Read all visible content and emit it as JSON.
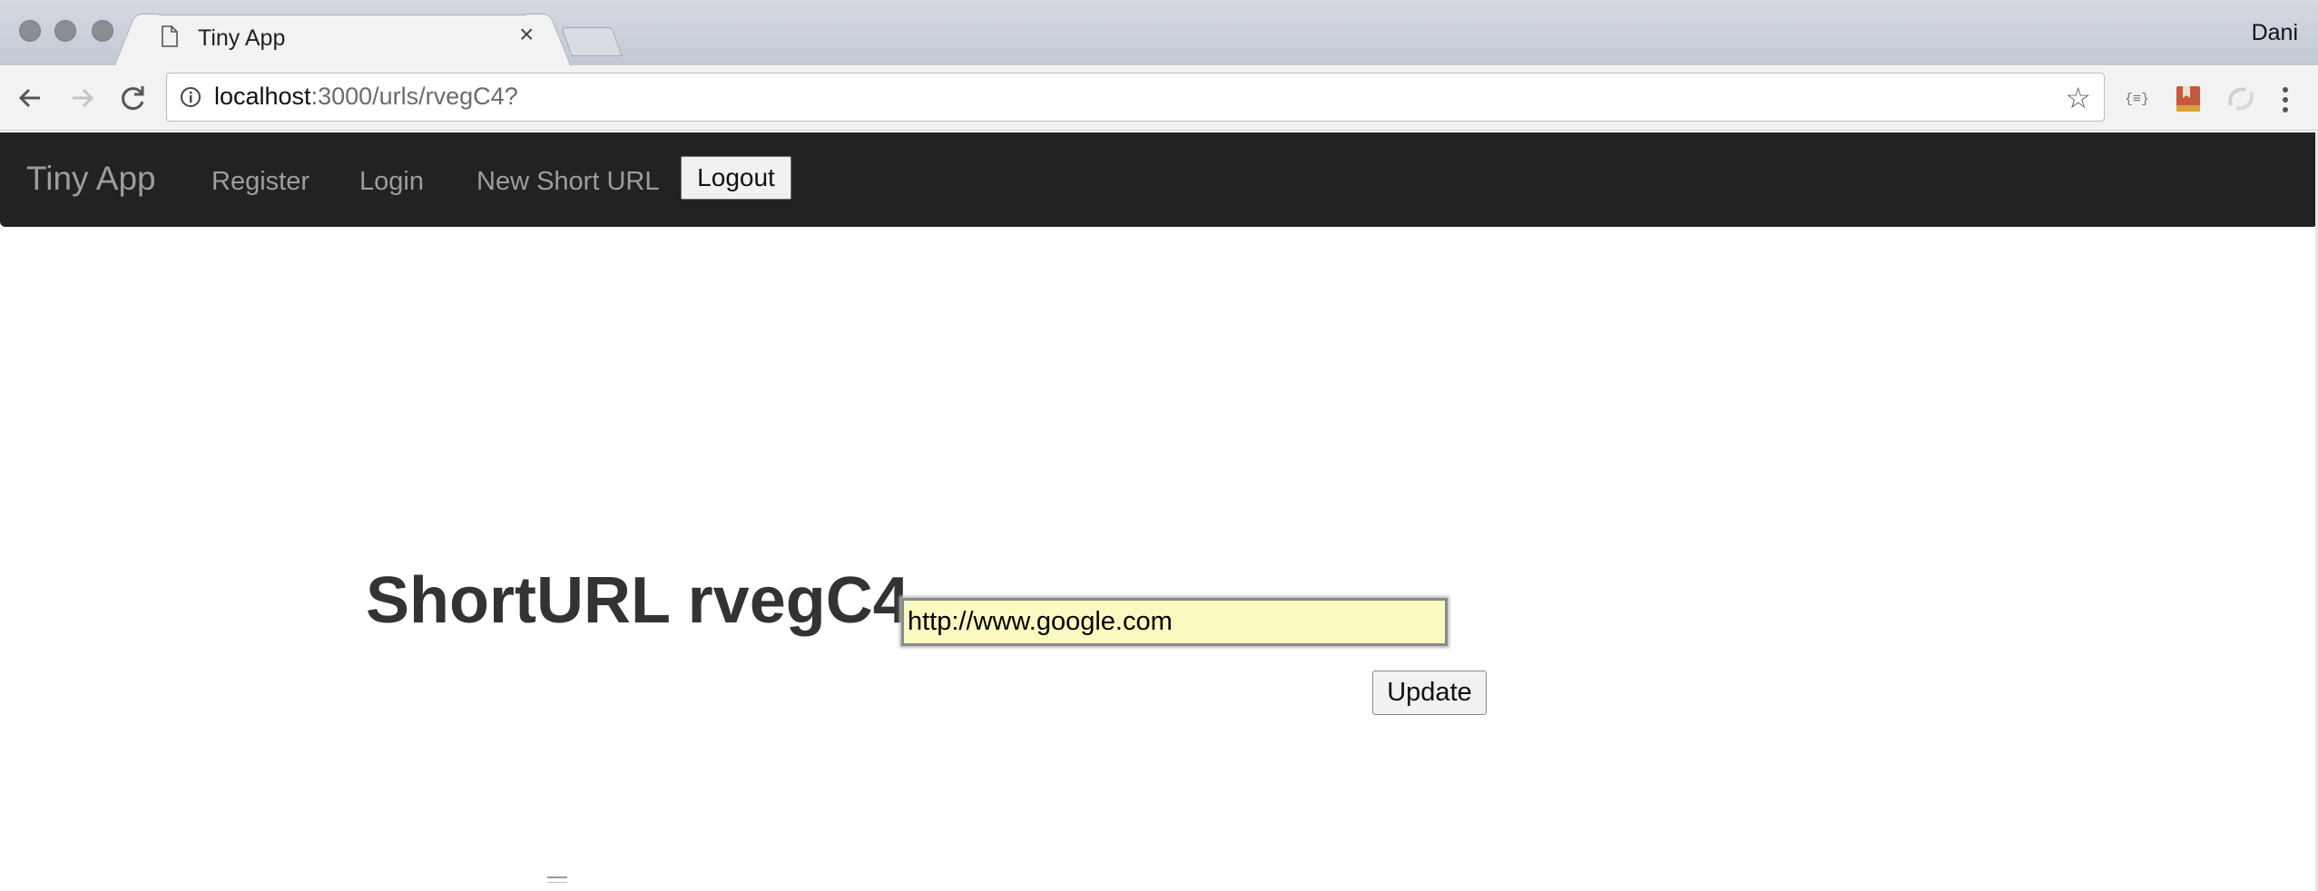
{
  "browser": {
    "tab_title": "Tiny App",
    "tab_close": "×",
    "profile_name": "Dani",
    "url_host": "localhost",
    "url_rest": ":3000/urls/rvegC4?",
    "icons": [
      "close-window-icon",
      "minimize-window-icon",
      "zoom-window-icon",
      "page-icon",
      "back-arrow-icon",
      "forward-arrow-icon",
      "reload-icon",
      "info-icon",
      "star-icon",
      "json-extension-icon",
      "bookmark-extension-icon",
      "sync-extension-icon",
      "menu-dots-icon"
    ]
  },
  "navbar": {
    "brand": "Tiny App",
    "links": {
      "register": "Register",
      "login": "Login",
      "new_short_url": "New Short URL"
    },
    "logout_label": "Logout"
  },
  "main": {
    "heading": "ShortURL rvegC4",
    "long_url_value": "http://www.google.com",
    "update_label": "Update"
  },
  "colors": {
    "navbar_bg": "#222222",
    "navbar_text": "#9d9d9d",
    "input_bg": "#fafac0"
  }
}
